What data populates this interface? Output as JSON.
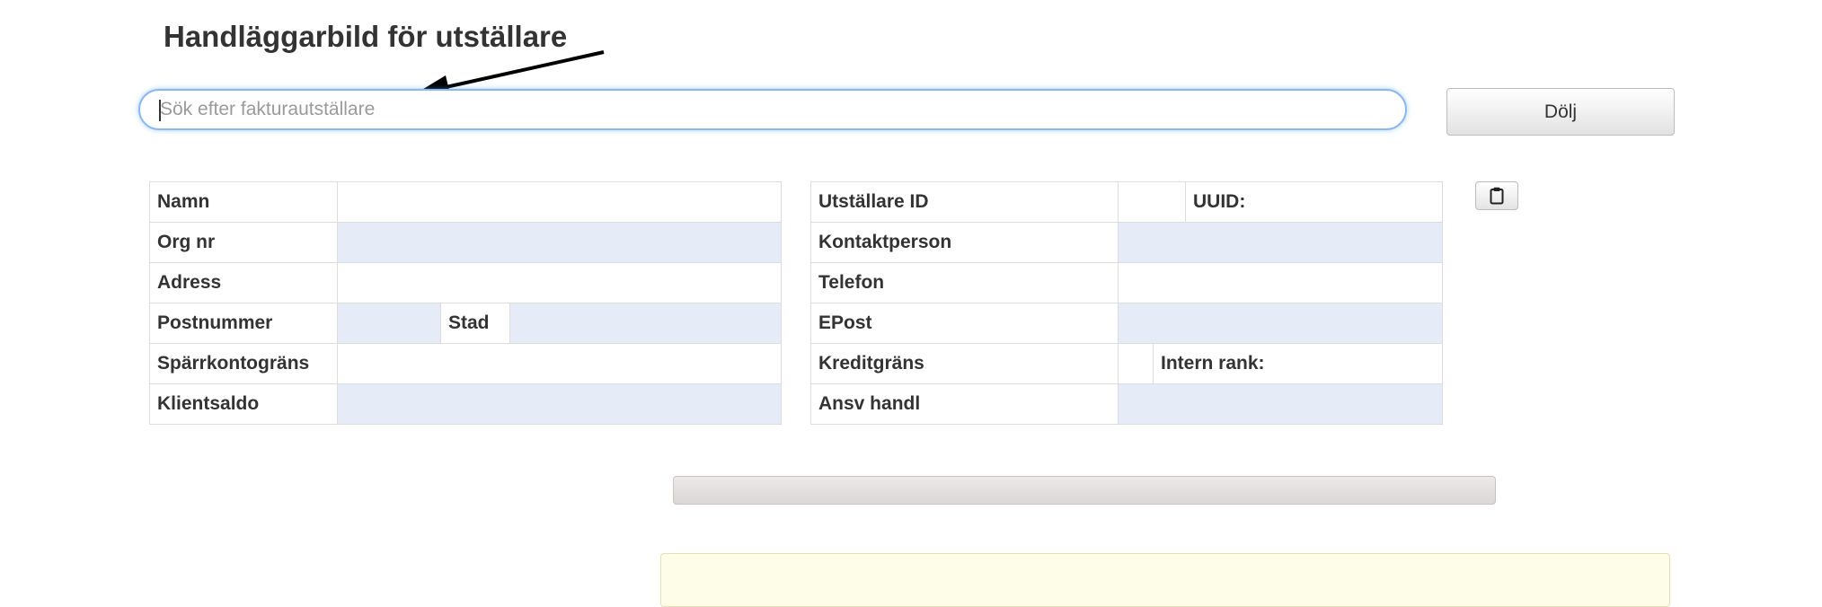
{
  "page": {
    "title": "Handläggarbild för utställare"
  },
  "search": {
    "placeholder": "Sök efter fakturautställare",
    "value": ""
  },
  "toolbar": {
    "hide_label": "Dölj"
  },
  "issuer_table": {
    "rows": [
      {
        "label": "Namn",
        "value": ""
      },
      {
        "label": "Org nr",
        "value": ""
      },
      {
        "label": "Adress",
        "value": ""
      },
      {
        "label": "Postnummer",
        "value": "",
        "city_label": "Stad",
        "city_value": ""
      },
      {
        "label": "Spärrkontogräns",
        "value": ""
      },
      {
        "label": "Klientsaldo",
        "value": ""
      }
    ]
  },
  "contact_table": {
    "rows": [
      {
        "label": "Utställare ID",
        "value": "",
        "uuid_label": "UUID:",
        "uuid_value": ""
      },
      {
        "label": "Kontaktperson",
        "value": ""
      },
      {
        "label": "Telefon",
        "value": ""
      },
      {
        "label": "EPost",
        "value": ""
      },
      {
        "label": "Kreditgräns",
        "value": "",
        "rank_label": "Intern rank:",
        "rank_value": ""
      },
      {
        "label": "Ansv handl",
        "value": ""
      }
    ]
  },
  "icons": {
    "copy": "clipboard-icon",
    "annotation": "arrow-annotation"
  },
  "progress": {
    "fraction": 0
  },
  "colors": {
    "shaded_cell": "#e6ecf7",
    "search_focus": "#8cb7f0",
    "notice_bg": "#fefee8"
  }
}
